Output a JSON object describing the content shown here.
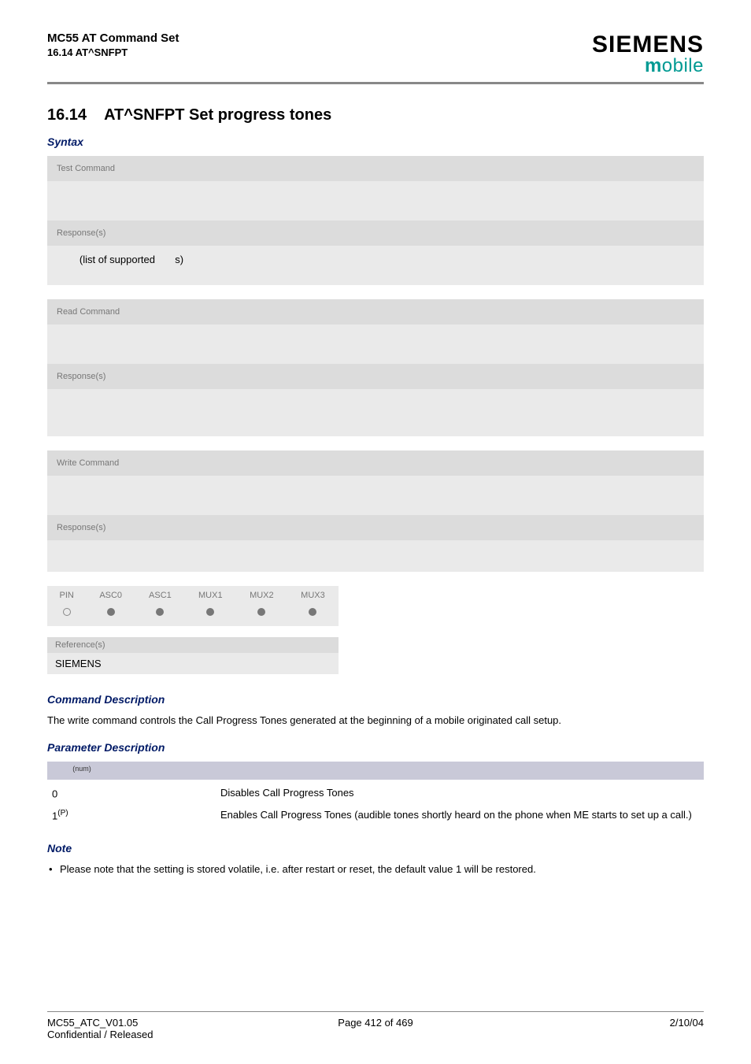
{
  "header": {
    "title_line1": "MC55 AT Command Set",
    "title_line2": "16.14 AT^SNFPT",
    "brand_siemens": "SIEMENS",
    "brand_mobile_m": "m",
    "brand_mobile_rest": "obile"
  },
  "section": {
    "number": "16.14",
    "title": "AT^SNFPT   Set progress tones"
  },
  "syntax_label": "Syntax",
  "panels": {
    "test": {
      "label": "Test Command",
      "cmd": "",
      "resp_label": "Response(s)",
      "resp_line": "        (list of supported       s)"
    },
    "read": {
      "label": "Read Command",
      "cmd": "",
      "resp_label": "Response(s)",
      "resp_line": ""
    },
    "write": {
      "label": "Write Command",
      "cmd": "",
      "resp_label": "Response(s)",
      "resp_line": ""
    }
  },
  "pin_table": {
    "headers": [
      "PIN",
      "ASC0",
      "ASC1",
      "MUX1",
      "MUX2",
      "MUX3"
    ],
    "dots": [
      "open",
      "fill",
      "fill",
      "fill",
      "fill",
      "fill"
    ]
  },
  "reference": {
    "label": "Reference(s)",
    "value": "SIEMENS"
  },
  "cmd_desc": {
    "heading": "Command Description",
    "text": "The write command controls the Call Progress Tones generated at the beginning of a mobile originated call setup."
  },
  "param_desc": {
    "heading": "Parameter Description",
    "badge_sup": "(num)",
    "rows": [
      {
        "key": "0",
        "sup": "",
        "desc": "Disables Call Progress Tones"
      },
      {
        "key": "1",
        "sup": "(P)",
        "desc": "Enables Call Progress Tones (audible tones shortly heard on the phone when ME starts to set up a call.)"
      }
    ]
  },
  "note": {
    "heading": "Note",
    "item": "Please note that the setting is stored volatile, i.e. after restart or reset, the default value 1 will be restored."
  },
  "footer": {
    "left_line1": "MC55_ATC_V01.05",
    "left_line2": "Confidential / Released",
    "center": "Page 412 of 469",
    "right": "2/10/04"
  }
}
